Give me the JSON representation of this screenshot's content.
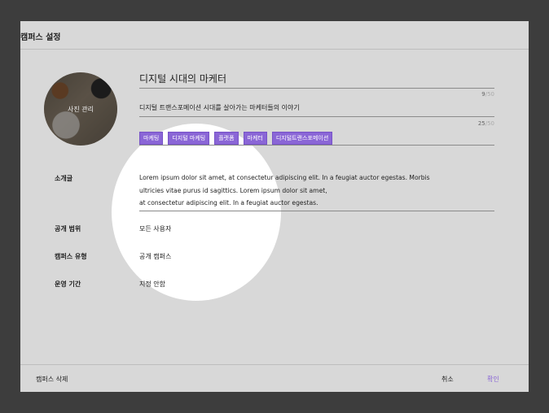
{
  "header": {
    "title": "캠퍼스 설정"
  },
  "photo": {
    "label": "사진 관리"
  },
  "name": {
    "value": "디지털 시대의 마케터",
    "count": "9",
    "max": "/50"
  },
  "description": {
    "value": "디지털 트랜스포메이션 시대를 살아가는 마케터들의 이야기",
    "count": "25",
    "max": "/50"
  },
  "tags": [
    "마케팅",
    "디지털 마케팅",
    "플랫폼",
    "마케터",
    "디지털트랜스포메이션"
  ],
  "intro": {
    "label": "소개글",
    "lines": [
      "Lorem ipsum dolor sit amet, at consectetur adipiscing elit. In a feugiat auctor egestas. Morbis",
      "ultricies vitae purus id sagittics. Lorem ipsum dolor sit amet,",
      "at consectetur adipiscing elit. In a feugiat auctor egestas."
    ]
  },
  "visibility": {
    "label": "공개 범위",
    "value": "모든 사용자"
  },
  "campus_type": {
    "label": "캠퍼스 유형",
    "value": "공개 캠퍼스"
  },
  "period": {
    "label": "운영 기간",
    "value": "지정 안함"
  },
  "footer": {
    "delete_label": "캠퍼스 삭제",
    "cancel_label": "취소",
    "confirm_label": "확인"
  },
  "colors": {
    "accent": "#8a66d6",
    "backdrop": "#3d3d3d",
    "dialog": "#d8d8d8"
  }
}
